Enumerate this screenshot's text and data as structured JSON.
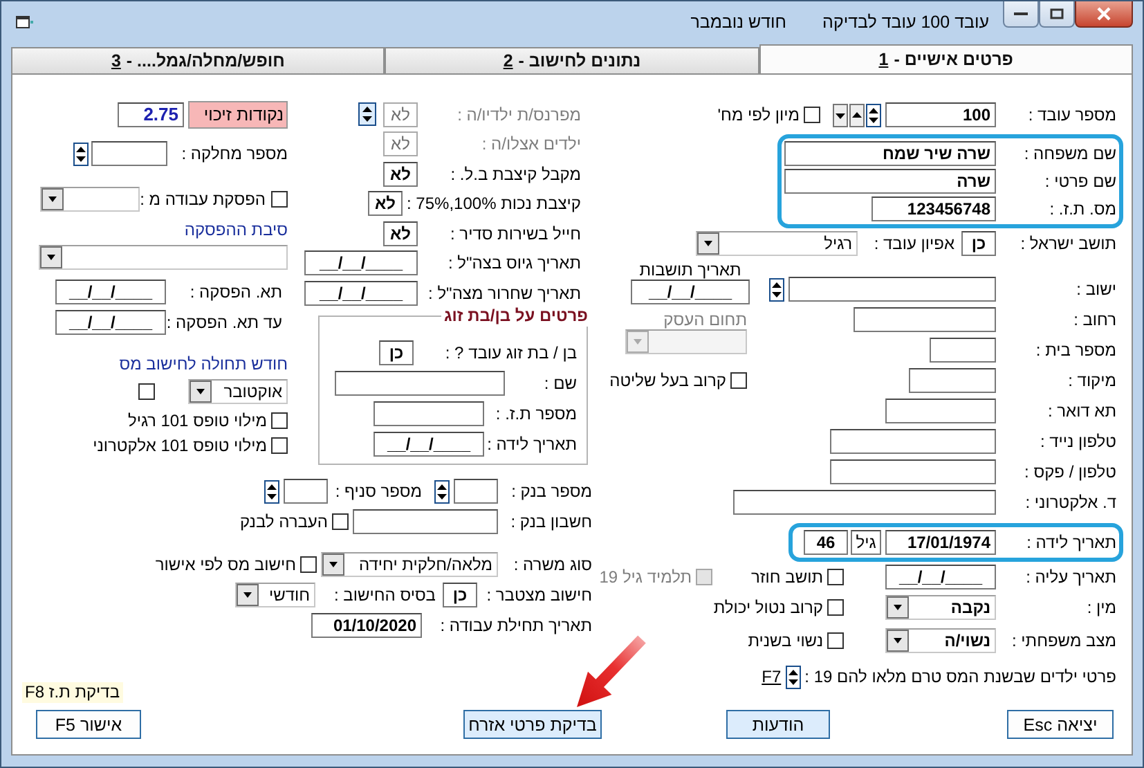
{
  "window": {
    "title": "עובד 100 עובד לבדיקה",
    "month": "חודש נובמבר"
  },
  "tabs": [
    {
      "label": "פרטים אישיים -",
      "key": "1",
      "selected": true
    },
    {
      "label": "נתונים לחישוב -",
      "key": "2",
      "selected": false
    },
    {
      "label": "חופש/מחלה/גמל.... -",
      "key": "3",
      "selected": false
    }
  ],
  "employee": {
    "label": "מספר עובד :",
    "value": "100",
    "sort": {
      "label": "מיון לפי מח'",
      "checked": false
    }
  },
  "identity": [
    {
      "label": "שם משפחה :",
      "value": "שרה שיר שמח"
    },
    {
      "label": "שם פרטי :",
      "value": "שרה"
    },
    {
      "label": "מס. ת.ז. :",
      "value": "123456748"
    }
  ],
  "resident": {
    "label": "תושב ישראל :",
    "value": "כן",
    "type_label": "אפיון עובד :",
    "type_value": "רגיל"
  },
  "residency_date": {
    "label": "תאריך תושבות",
    "value": "__/__/____"
  },
  "business": {
    "label": "תחום העסק",
    "disabled": true
  },
  "controlling_relative": {
    "label": "קרוב בעל שליטה",
    "checked": false
  },
  "address": [
    {
      "label": "ישוב :"
    },
    {
      "label": "רחוב :"
    },
    {
      "label": "מספר בית :"
    },
    {
      "label": "מיקוד :"
    },
    {
      "label": "תא דואר :"
    },
    {
      "label": "טלפון נייד :"
    },
    {
      "label": "טלפון / פקס :"
    },
    {
      "label": "ד. אלקטרוני :"
    }
  ],
  "birth": {
    "label": "תאריך לידה :",
    "value": "17/01/1974",
    "age_label": "גיל",
    "age": "46"
  },
  "immigration": {
    "label": "תאריך עליה :",
    "value": "__/__/____"
  },
  "returning_resident": {
    "label": "תושב חוזר",
    "checked": false
  },
  "student_19": {
    "label": "תלמיד גיל 19",
    "checked": false,
    "disabled": true
  },
  "gender": {
    "label": "מין :",
    "value": "נקבה"
  },
  "disabled_relative": {
    "label": "קרוב נטול יכולת",
    "checked": false
  },
  "marital": {
    "label": "מצב משפחתי :",
    "value": "נשוי/ה"
  },
  "remarried": {
    "label": "נשוי בשנית",
    "checked": false
  },
  "children": {
    "label": "פרטי ילדים שבשנת המס טרם מלאו להם 19 :",
    "link": "F7"
  },
  "benefits": [
    {
      "label": "מפרנס/ת ילדיו/ה :",
      "value": "לא",
      "disabled": true
    },
    {
      "label": "ילדים אצלו/ה :",
      "value": "לא",
      "disabled": true
    },
    {
      "label": "מקבל קיצבת  ב.ל. :",
      "value": "לא",
      "disabled": false
    },
    {
      "label": "קיצבת נכות 100%,75% :",
      "value": "לא",
      "disabled": false
    },
    {
      "label": "חייל בשירות סדיר :",
      "value": "לא",
      "disabled": false
    }
  ],
  "army_dates": [
    {
      "label": "תאריך גיוס בצה\"ל :",
      "value": "__/__/____"
    },
    {
      "label": "תאריך שחרור מצה\"ל :",
      "value": "__/__/____"
    }
  ],
  "spouse": {
    "title": "פרטים על בן/בת זוג",
    "works_label": "בן / בת זוג עובד ? :",
    "works": "כן",
    "name_label": "שם :",
    "id_label": "מספר ת.ז. :",
    "birth_label": "תאריך לידה :",
    "birth": "__/__/____"
  },
  "credit_points": {
    "label": "נקודות זיכוי",
    "value": "2.75"
  },
  "department": {
    "label": "מספר מחלקה :"
  },
  "termination": {
    "label": "הפסקת עבודה מ :",
    "checked": false,
    "reason_label": "סיבת ההפסקה",
    "dates": [
      {
        "label": "תא. הפסקה :",
        "value": "__/__/____"
      },
      {
        "label": "עד תא. הפסקה :",
        "value": "__/__/____"
      }
    ]
  },
  "tax_month": {
    "label": "חודש תחולה לחישוב מס",
    "value": "אוקטובר",
    "checked": false
  },
  "form101": [
    {
      "label": "מילוי טופס 101 רגיל",
      "checked": false
    },
    {
      "label": "מילוי טופס 101 אלקטרוני",
      "checked": false
    }
  ],
  "bank": {
    "bank_label": "מספר בנק :",
    "branch_label": "מספר סניף :",
    "account_label": "חשבון בנק :",
    "transfer": {
      "label": "העברה לבנק",
      "checked": false
    }
  },
  "job": {
    "label": "סוג משרה :",
    "value": "מלאה/חלקית יחידה",
    "tax_by_approval": {
      "label": "חישוב מס לפי אישור",
      "checked": false
    }
  },
  "cumulative": {
    "label": "חישוב מצטבר :",
    "value": "כן",
    "basis_label": "בסיס החישוב :",
    "basis": "חודשי"
  },
  "start_date": {
    "label": "תאריך תחילת עבודה :",
    "value": "01/10/2020"
  },
  "id_check_hint": "בדיקת ת.ז F8",
  "buttons": [
    {
      "label": "יציאה Esc",
      "kind": "exit"
    },
    {
      "label": "הודעות",
      "kind": "info"
    },
    {
      "label": "בדיקת פרטי אזרח",
      "kind": "check"
    },
    {
      "label": "אישור F5",
      "kind": "confirm"
    }
  ]
}
